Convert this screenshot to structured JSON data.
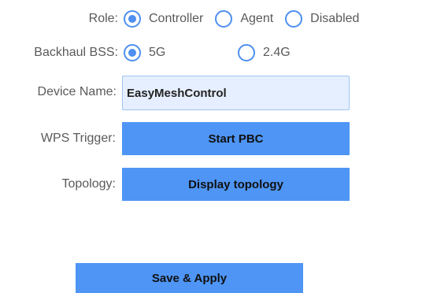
{
  "role": {
    "label": "Role:",
    "options": [
      {
        "label": "Controller",
        "selected": true
      },
      {
        "label": "Agent",
        "selected": false
      },
      {
        "label": "Disabled",
        "selected": false
      }
    ]
  },
  "backhaul": {
    "label": "Backhaul BSS:",
    "options": [
      {
        "label": "5G",
        "selected": true
      },
      {
        "label": "2.4G",
        "selected": false
      }
    ]
  },
  "device_name": {
    "label": "Device Name:",
    "value": "EasyMeshControl"
  },
  "wps": {
    "label": "WPS Trigger:",
    "button_label": "Start PBC"
  },
  "topology": {
    "label": "Topology:",
    "button_label": "Display topology"
  },
  "save": {
    "button_label": "Save & Apply"
  },
  "colors": {
    "accent": "#4e8ff0",
    "button": "#4e95f5",
    "input_bg": "#e6efff"
  }
}
